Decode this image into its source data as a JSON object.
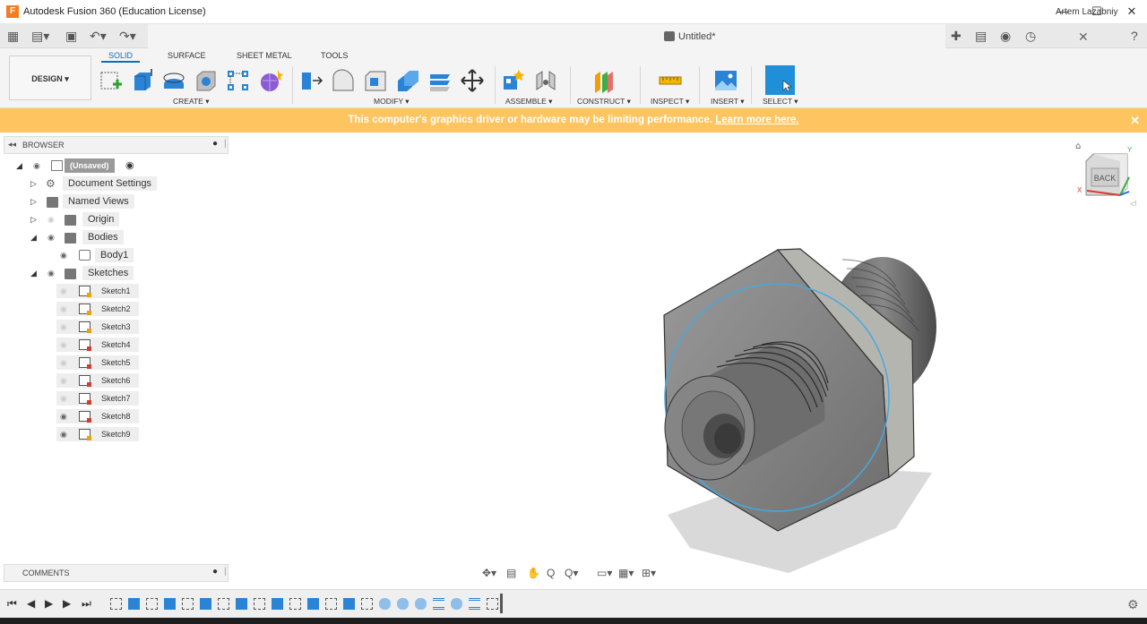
{
  "window": {
    "title": "Autodesk Fusion 360 (Education License)",
    "minimize": "—",
    "maximize": "☐",
    "close": "✕"
  },
  "document": {
    "title": "Untitled*",
    "user": "Artem Lazabniy"
  },
  "toolbar": {
    "design": "DESIGN ▾",
    "tabs": [
      "SOLID",
      "SURFACE",
      "SHEET METAL",
      "TOOLS"
    ],
    "groups": {
      "create": "CREATE ▾",
      "modify": "MODIFY ▾",
      "assemble": "ASSEMBLE ▾",
      "construct": "CONSTRUCT ▾",
      "inspect": "INSPECT ▾",
      "insert": "INSERT ▾",
      "select": "SELECT ▾"
    }
  },
  "banner": {
    "message": "This computer's graphics driver or hardware may be limiting performance.",
    "link": "Learn more here.",
    "close": "✕"
  },
  "browser": {
    "title": "BROWSER",
    "root": "(Unsaved)",
    "items": [
      {
        "label": "Document Settings"
      },
      {
        "label": "Named Views"
      },
      {
        "label": "Origin"
      },
      {
        "label": "Bodies"
      },
      {
        "label": "Body1"
      },
      {
        "label": "Sketches"
      }
    ],
    "sketches": [
      "Sketch1",
      "Sketch2",
      "Sketch3",
      "Sketch4",
      "Sketch5",
      "Sketch6",
      "Sketch7",
      "Sketch8",
      "Sketch9"
    ]
  },
  "comments": {
    "title": "COMMENTS"
  },
  "viewcube": {
    "face": "BACK",
    "axis_x": "X",
    "axis_y": "Y"
  },
  "colors": {
    "accent": "#0a6ebd",
    "banner": "#fec45f",
    "select": "#1e8fd8"
  }
}
